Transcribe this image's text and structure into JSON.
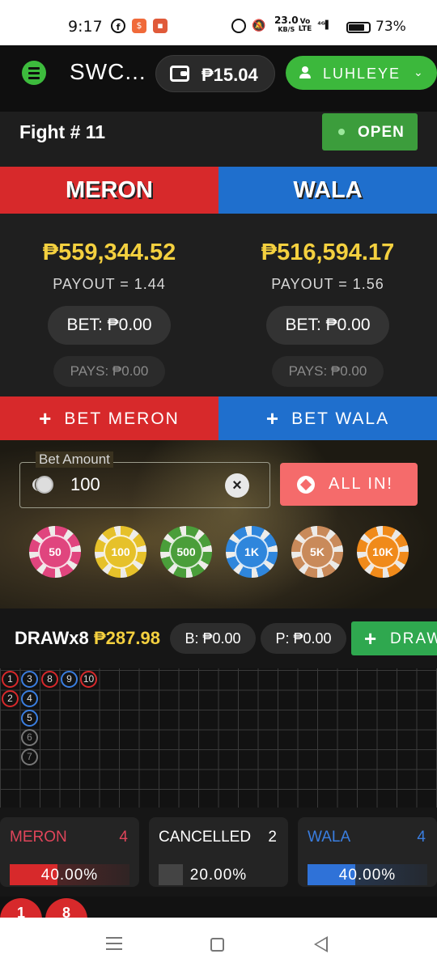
{
  "status_bar": {
    "time": "9:17",
    "net_speed": "23.0",
    "net_unit": "KB/S",
    "battery": "73%"
  },
  "header": {
    "brand": "SWC...",
    "balance": "₱15.04",
    "username": "LUHLEYE"
  },
  "fight": {
    "title": "Fight # 11",
    "status": "OPEN"
  },
  "meron": {
    "label": "MERON",
    "pool": "₱559,344.52",
    "payout": "PAYOUT = 1.44",
    "bet": "BET: ₱0.00",
    "pays": "PAYS: ₱0.00",
    "button": "BET MERON",
    "color": "#d7292b"
  },
  "wala": {
    "label": "WALA",
    "pool": "₱516,594.17",
    "payout": "PAYOUT = 1.56",
    "bet": "BET: ₱0.00",
    "pays": "PAYS: ₱0.00",
    "button": "BET WALA",
    "color": "#1f6fcd"
  },
  "bet_input": {
    "label": "Bet Amount",
    "value": "100",
    "all_in": "ALL IN!"
  },
  "chips": [
    {
      "label": "50",
      "color": "#e0457e"
    },
    {
      "label": "100",
      "color": "#e6c12a"
    },
    {
      "label": "500",
      "color": "#4a9e3a"
    },
    {
      "label": "1K",
      "color": "#2f86dc"
    },
    {
      "label": "5K",
      "color": "#c98a5a"
    },
    {
      "label": "10K",
      "color": "#f08a1a"
    }
  ],
  "draw": {
    "label": "DRAWx8",
    "amount": "₱287.98",
    "b": "B: ₱0.00",
    "p": "P: ₱0.00",
    "button": "DRAW"
  },
  "trend": [
    {
      "n": "1",
      "c": "r"
    },
    {
      "n": "2",
      "c": "r"
    },
    {
      "n": "3",
      "c": "b"
    },
    {
      "n": "4",
      "c": "b"
    },
    {
      "n": "5",
      "c": "b"
    },
    {
      "n": "6",
      "c": "g"
    },
    {
      "n": "7",
      "c": "g"
    },
    {
      "n": "8",
      "c": "r"
    },
    {
      "n": "9",
      "c": "b"
    },
    {
      "n": "10",
      "c": "r"
    }
  ],
  "stats": [
    {
      "name": "MERON",
      "count": "4",
      "percent": "40.00%",
      "fill": 0.4,
      "color": "#d7292b"
    },
    {
      "name": "CANCELLED",
      "count": "2",
      "percent": "20.00%",
      "fill": 0.2,
      "color": "#444444"
    },
    {
      "name": "WALA",
      "count": "4",
      "percent": "40.00%",
      "fill": 0.4,
      "color": "#2f72d8"
    }
  ],
  "bottom_strip": [
    "1",
    "8"
  ]
}
